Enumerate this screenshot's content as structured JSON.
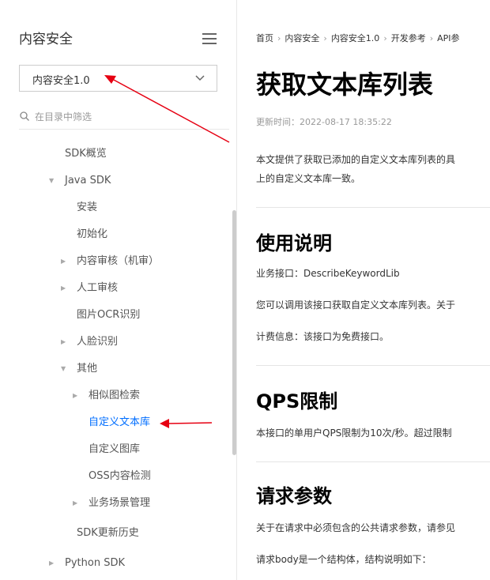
{
  "sidebar": {
    "title": "内容安全",
    "version": "内容安全1.0",
    "search_placeholder": "在目录中筛选",
    "items": [
      {
        "label": "SDK概览"
      },
      {
        "label": "Java SDK"
      },
      {
        "label": "安装"
      },
      {
        "label": "初始化"
      },
      {
        "label": "内容审核（机审）"
      },
      {
        "label": "人工审核"
      },
      {
        "label": "图片OCR识别"
      },
      {
        "label": "人脸识别"
      },
      {
        "label": "其他"
      },
      {
        "label": "相似图检索"
      },
      {
        "label": "自定义文本库"
      },
      {
        "label": "自定义图库"
      },
      {
        "label": "OSS内容检测"
      },
      {
        "label": "业务场景管理"
      },
      {
        "label": "SDK更新历史"
      },
      {
        "label": "Python SDK"
      }
    ]
  },
  "breadcrumb": [
    "首页",
    "内容安全",
    "内容安全1.0",
    "开发参考",
    "API参"
  ],
  "article": {
    "title": "获取文本库列表",
    "updated": "更新时间：2022-08-17 18:35:22",
    "intro_1": "本文提供了获取已添加的自定义文本库列表的具",
    "intro_2": "上的自定义文本库一致。",
    "sec1_title": "使用说明",
    "sec1_p1": "业务接口：DescribeKeywordLib",
    "sec1_p2": "您可以调用该接口获取自定义文本库列表。关于",
    "sec1_p3": "计费信息：该接口为免费接口。",
    "sec2_title": "QPS限制",
    "sec2_p1": "本接口的单用户QPS限制为10次/秒。超过限制",
    "sec3_title": "请求参数",
    "sec3_p1": "关于在请求中必须包含的公共请求参数，请参见",
    "sec3_p2": "请求body是一个结构体，结构说明如下："
  },
  "colors": {
    "active": "#006eff",
    "annotation_arrow": "#e60012"
  }
}
